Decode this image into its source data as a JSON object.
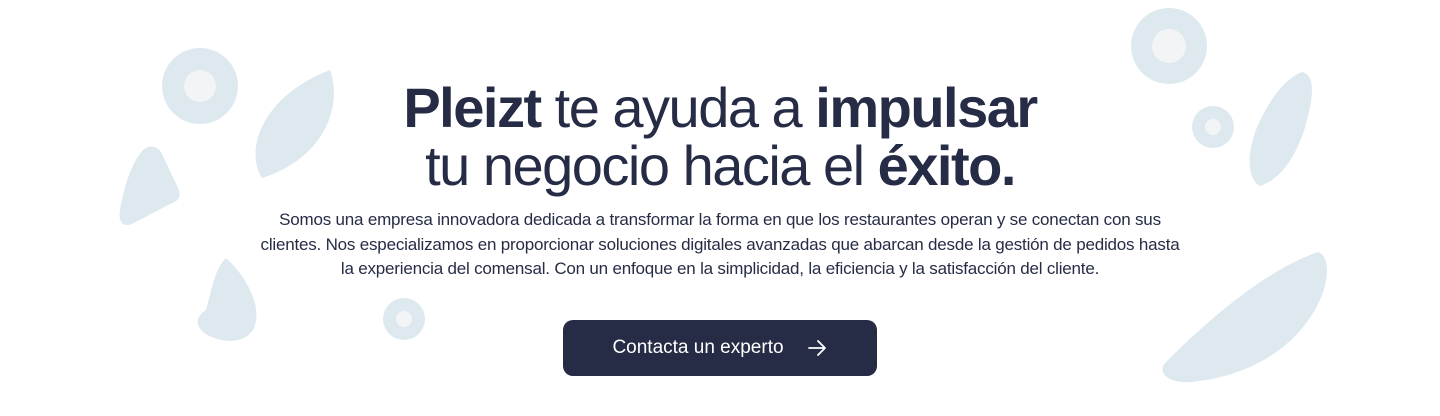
{
  "hero": {
    "headline": {
      "line1": {
        "brand": "Pleizt",
        "middle": " te ayuda a ",
        "emphasis": "impulsar"
      },
      "line2": {
        "start": "tu negocio hacia el ",
        "emphasis": "éxito."
      }
    },
    "description": "Somos una empresa innovadora dedicada a transformar la forma en que los restaurantes operan y se conectan con sus clientes. Nos especializamos en proporcionar soluciones digitales avanzadas que abarcan desde la gestión de pedidos hasta la experiencia del comensal. Con un enfoque en la simplicidad, la eficiencia y la satisfacción del cliente.",
    "cta": {
      "label": "Contacta un experto",
      "icon": "arrow-right-icon"
    }
  },
  "colors": {
    "text": "#262c45",
    "button_bg": "#262c45",
    "button_text": "#ffffff",
    "decor_shape": "#dde9ef",
    "decor_inner": "#f3f4f6",
    "background": "#ffffff"
  }
}
